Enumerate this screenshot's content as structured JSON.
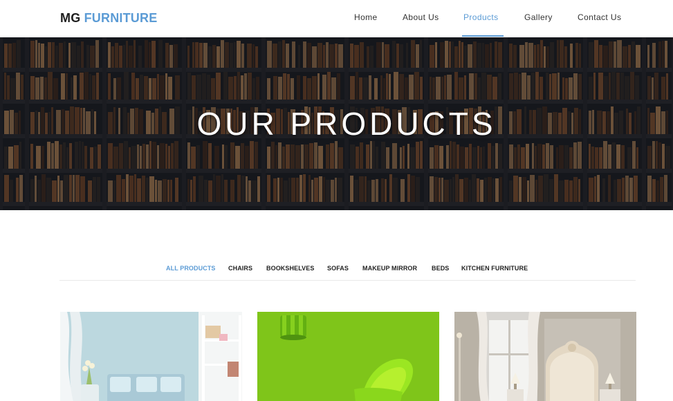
{
  "header": {
    "logo_part1": "MG",
    "logo_part2": "FURNITURE",
    "nav": [
      {
        "label": "Home"
      },
      {
        "label": "About Us"
      },
      {
        "label": "Products",
        "active": true
      },
      {
        "label": "Gallery"
      },
      {
        "label": "Contact Us"
      }
    ]
  },
  "hero": {
    "title": "OUR PRODUCTS"
  },
  "filters": [
    {
      "label": "ALL PRODUCTS",
      "active": true
    },
    {
      "label": "CHAIRS"
    },
    {
      "label": "BOOKSHELVES"
    },
    {
      "label": "SOFAS"
    },
    {
      "label": "MAKEUP MIRROR"
    },
    {
      "label": "BEDS"
    },
    {
      "label": "KITCHEN FURNITURE"
    }
  ],
  "products": [
    {
      "image": "living-room-sofa-photo"
    },
    {
      "image": "green-chair-photo"
    },
    {
      "image": "bedroom-bed-photo"
    }
  ],
  "colors": {
    "accent": "#5b9bd5",
    "text": "#222222"
  }
}
